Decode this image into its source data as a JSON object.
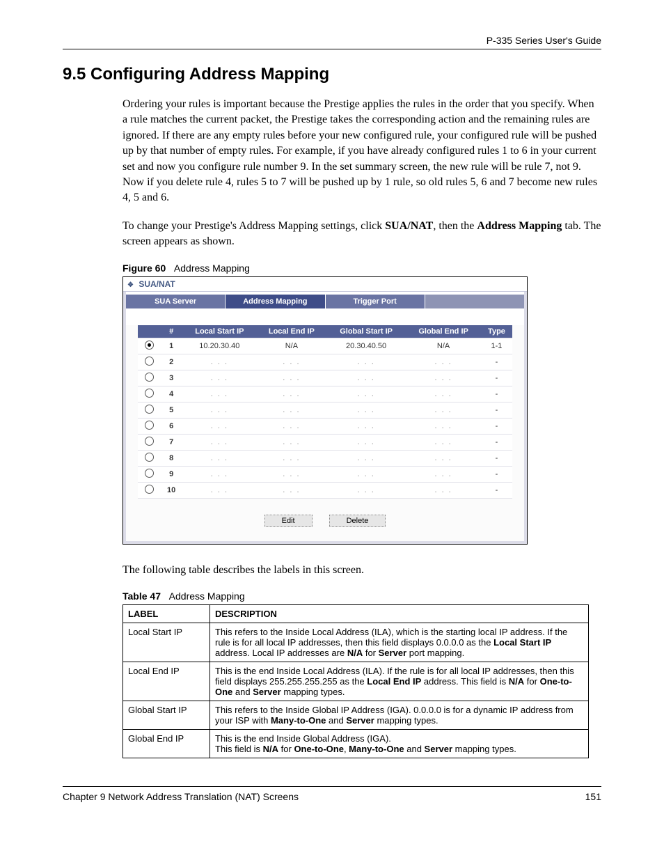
{
  "header_right": "P-335 Series User's Guide",
  "section_title": "9.5  Configuring Address Mapping",
  "para1": "Ordering your rules is important because the Prestige applies the rules in the order that you specify. When a rule matches the current packet, the Prestige takes the corresponding action and the remaining rules are ignored. If there are any empty rules before your new configured rule, your configured rule will be pushed up by that number of empty rules. For example, if you have already configured rules 1 to 6 in your current set and now you configure rule number 9. In the set summary screen, the new rule will be rule 7, not 9. Now if you delete rule 4, rules 5 to 7 will be pushed up by 1 rule, so old rules 5, 6 and 7 become new rules 4, 5 and 6.",
  "para2_lead": "To change your Prestige's Address Mapping settings, click ",
  "para2_b1": "SUA/NAT",
  "para2_mid": ", then the ",
  "para2_b2": "Address Mapping",
  "para2_tail": " tab.  The screen appears as shown.",
  "fig_label": "Figure 60",
  "fig_title": "Address Mapping",
  "crumb": "SUA/NAT",
  "tabs": [
    "SUA Server",
    "Address Mapping",
    "Trigger Port"
  ],
  "active_tab": 1,
  "map_header": [
    "",
    "#",
    "Local Start IP",
    "Local End IP",
    "Global Start IP",
    "Global End IP",
    "Type"
  ],
  "map_rows": [
    {
      "sel": true,
      "n": "1",
      "lsi": "10.20.30.40",
      "lei": "N/A",
      "gsi": "20.30.40.50",
      "gei": "N/A",
      "type": "1-1"
    },
    {
      "sel": false,
      "n": "2",
      "lsi": ". . .",
      "lei": ". . .",
      "gsi": ". . .",
      "gei": ". . .",
      "type": "-"
    },
    {
      "sel": false,
      "n": "3",
      "lsi": ". . .",
      "lei": ". . .",
      "gsi": ". . .",
      "gei": ". . .",
      "type": "-"
    },
    {
      "sel": false,
      "n": "4",
      "lsi": ". . .",
      "lei": ". . .",
      "gsi": ". . .",
      "gei": ". . .",
      "type": "-"
    },
    {
      "sel": false,
      "n": "5",
      "lsi": ". . .",
      "lei": ". . .",
      "gsi": ". . .",
      "gei": ". . .",
      "type": "-"
    },
    {
      "sel": false,
      "n": "6",
      "lsi": ". . .",
      "lei": ". . .",
      "gsi": ". . .",
      "gei": ". . .",
      "type": "-"
    },
    {
      "sel": false,
      "n": "7",
      "lsi": ". . .",
      "lei": ". . .",
      "gsi": ". . .",
      "gei": ". . .",
      "type": "-"
    },
    {
      "sel": false,
      "n": "8",
      "lsi": ". . .",
      "lei": ". . .",
      "gsi": ". . .",
      "gei": ". . .",
      "type": "-"
    },
    {
      "sel": false,
      "n": "9",
      "lsi": ". . .",
      "lei": ". . .",
      "gsi": ". . .",
      "gei": ". . .",
      "type": "-"
    },
    {
      "sel": false,
      "n": "10",
      "lsi": ". . .",
      "lei": ". . .",
      "gsi": ". . .",
      "gei": ". . .",
      "type": "-"
    }
  ],
  "btn_edit": "Edit",
  "btn_delete": "Delete",
  "after_fig": "The following table describes the labels in this screen.",
  "tbl_label": "Table 47",
  "tbl_title": "Address Mapping",
  "desc_header": [
    "LABEL",
    "DESCRIPTION"
  ],
  "desc_rows": [
    {
      "label": "Local Start IP",
      "html": "This refers to the Inside Local Address (ILA), which is the starting local IP address. If the rule is for all local IP addresses, then this field displays 0.0.0.0 as the <b>Local Start IP</b> address. Local IP addresses are <b>N/A</b> for <b>Server</b> port mapping."
    },
    {
      "label": "Local End IP",
      "html": "This is the end Inside Local Address (ILA). If the rule is for all local IP addresses, then this field displays 255.255.255.255 as the <b>Local End IP</b> address. This field is <b>N/A</b> for <b>One-to-One</b> and <b>Server</b> mapping types."
    },
    {
      "label": "Global Start IP",
      "html": "This refers to the Inside Global IP Address (IGA). 0.0.0.0 is for a dynamic IP address from your ISP with <b>Many-to-One</b> and <b>Server</b> mapping types."
    },
    {
      "label": "Global End IP",
      "html": "This is the end Inside Global Address (IGA).<br>This field is <b>N/A</b> for <b>One-to-One</b>, <b>Many-to-One</b> and <b>Server</b> mapping types."
    }
  ],
  "footer_left": "Chapter 9 Network Address Translation (NAT) Screens",
  "footer_right": "151"
}
